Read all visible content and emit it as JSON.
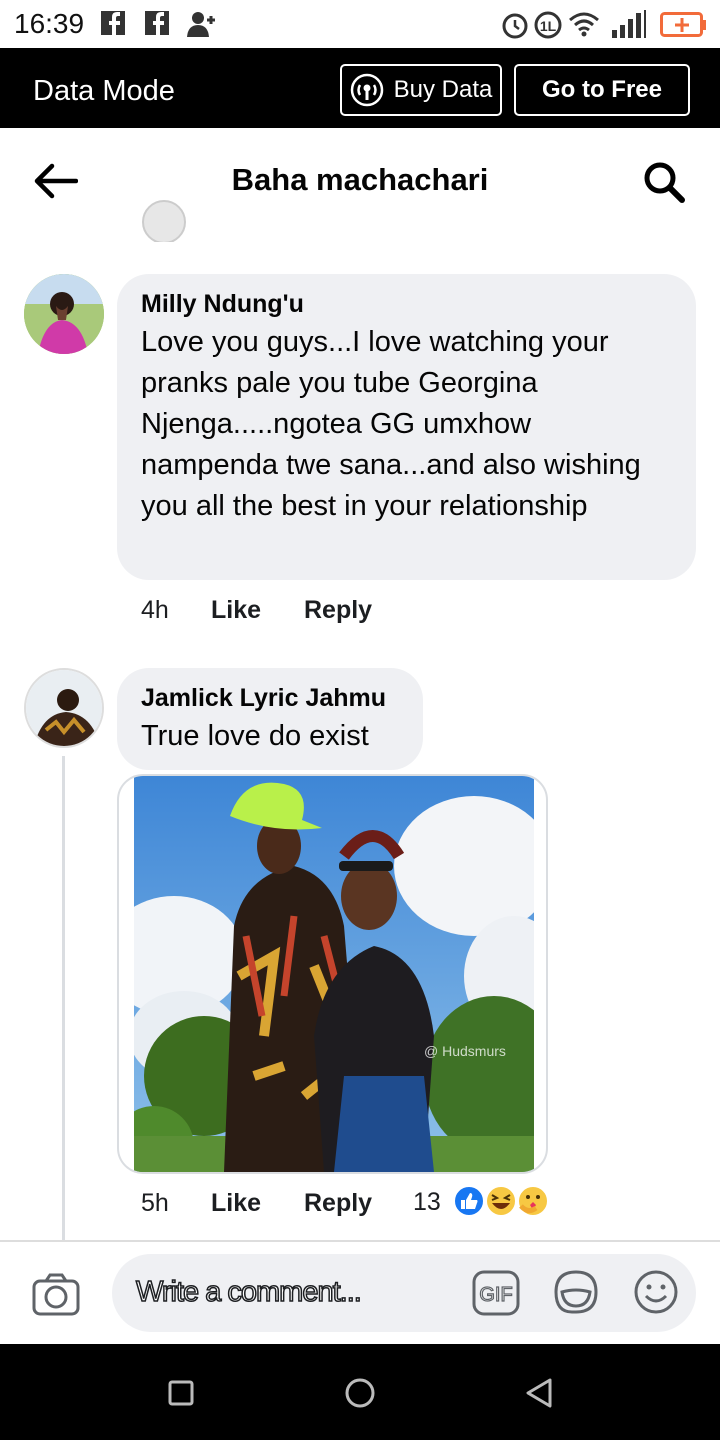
{
  "status_bar": {
    "time": "16:39",
    "battery_label": "+"
  },
  "data_mode": {
    "title": "Data Mode",
    "buy_label": "Buy Data",
    "free_label": "Go to Free"
  },
  "header": {
    "title": "Baha machachari"
  },
  "comments": [
    {
      "author": "Milly Ndung'u",
      "text": "Love you guys...I love watching your pranks pale you tube Georgina Njenga.....ngotea GG umxhow nampenda twe sana...and also wishing you all the best in your relationship",
      "time": "4h",
      "like": "Like",
      "reply": "Reply"
    },
    {
      "author": "Jamlick Lyric Jahmu",
      "text": "True love do exist",
      "time": "5h",
      "like": "Like",
      "reply": "Reply",
      "reaction_count": "13",
      "photo_watermark": "@ Hudsmurs"
    }
  ],
  "composer": {
    "placeholder": "Write a comment...",
    "gif_label": "GIF"
  },
  "colors": {
    "like_blue": "#1877f2",
    "bubble_gray": "#eff0f3",
    "battery_orange": "#f26b3a"
  }
}
